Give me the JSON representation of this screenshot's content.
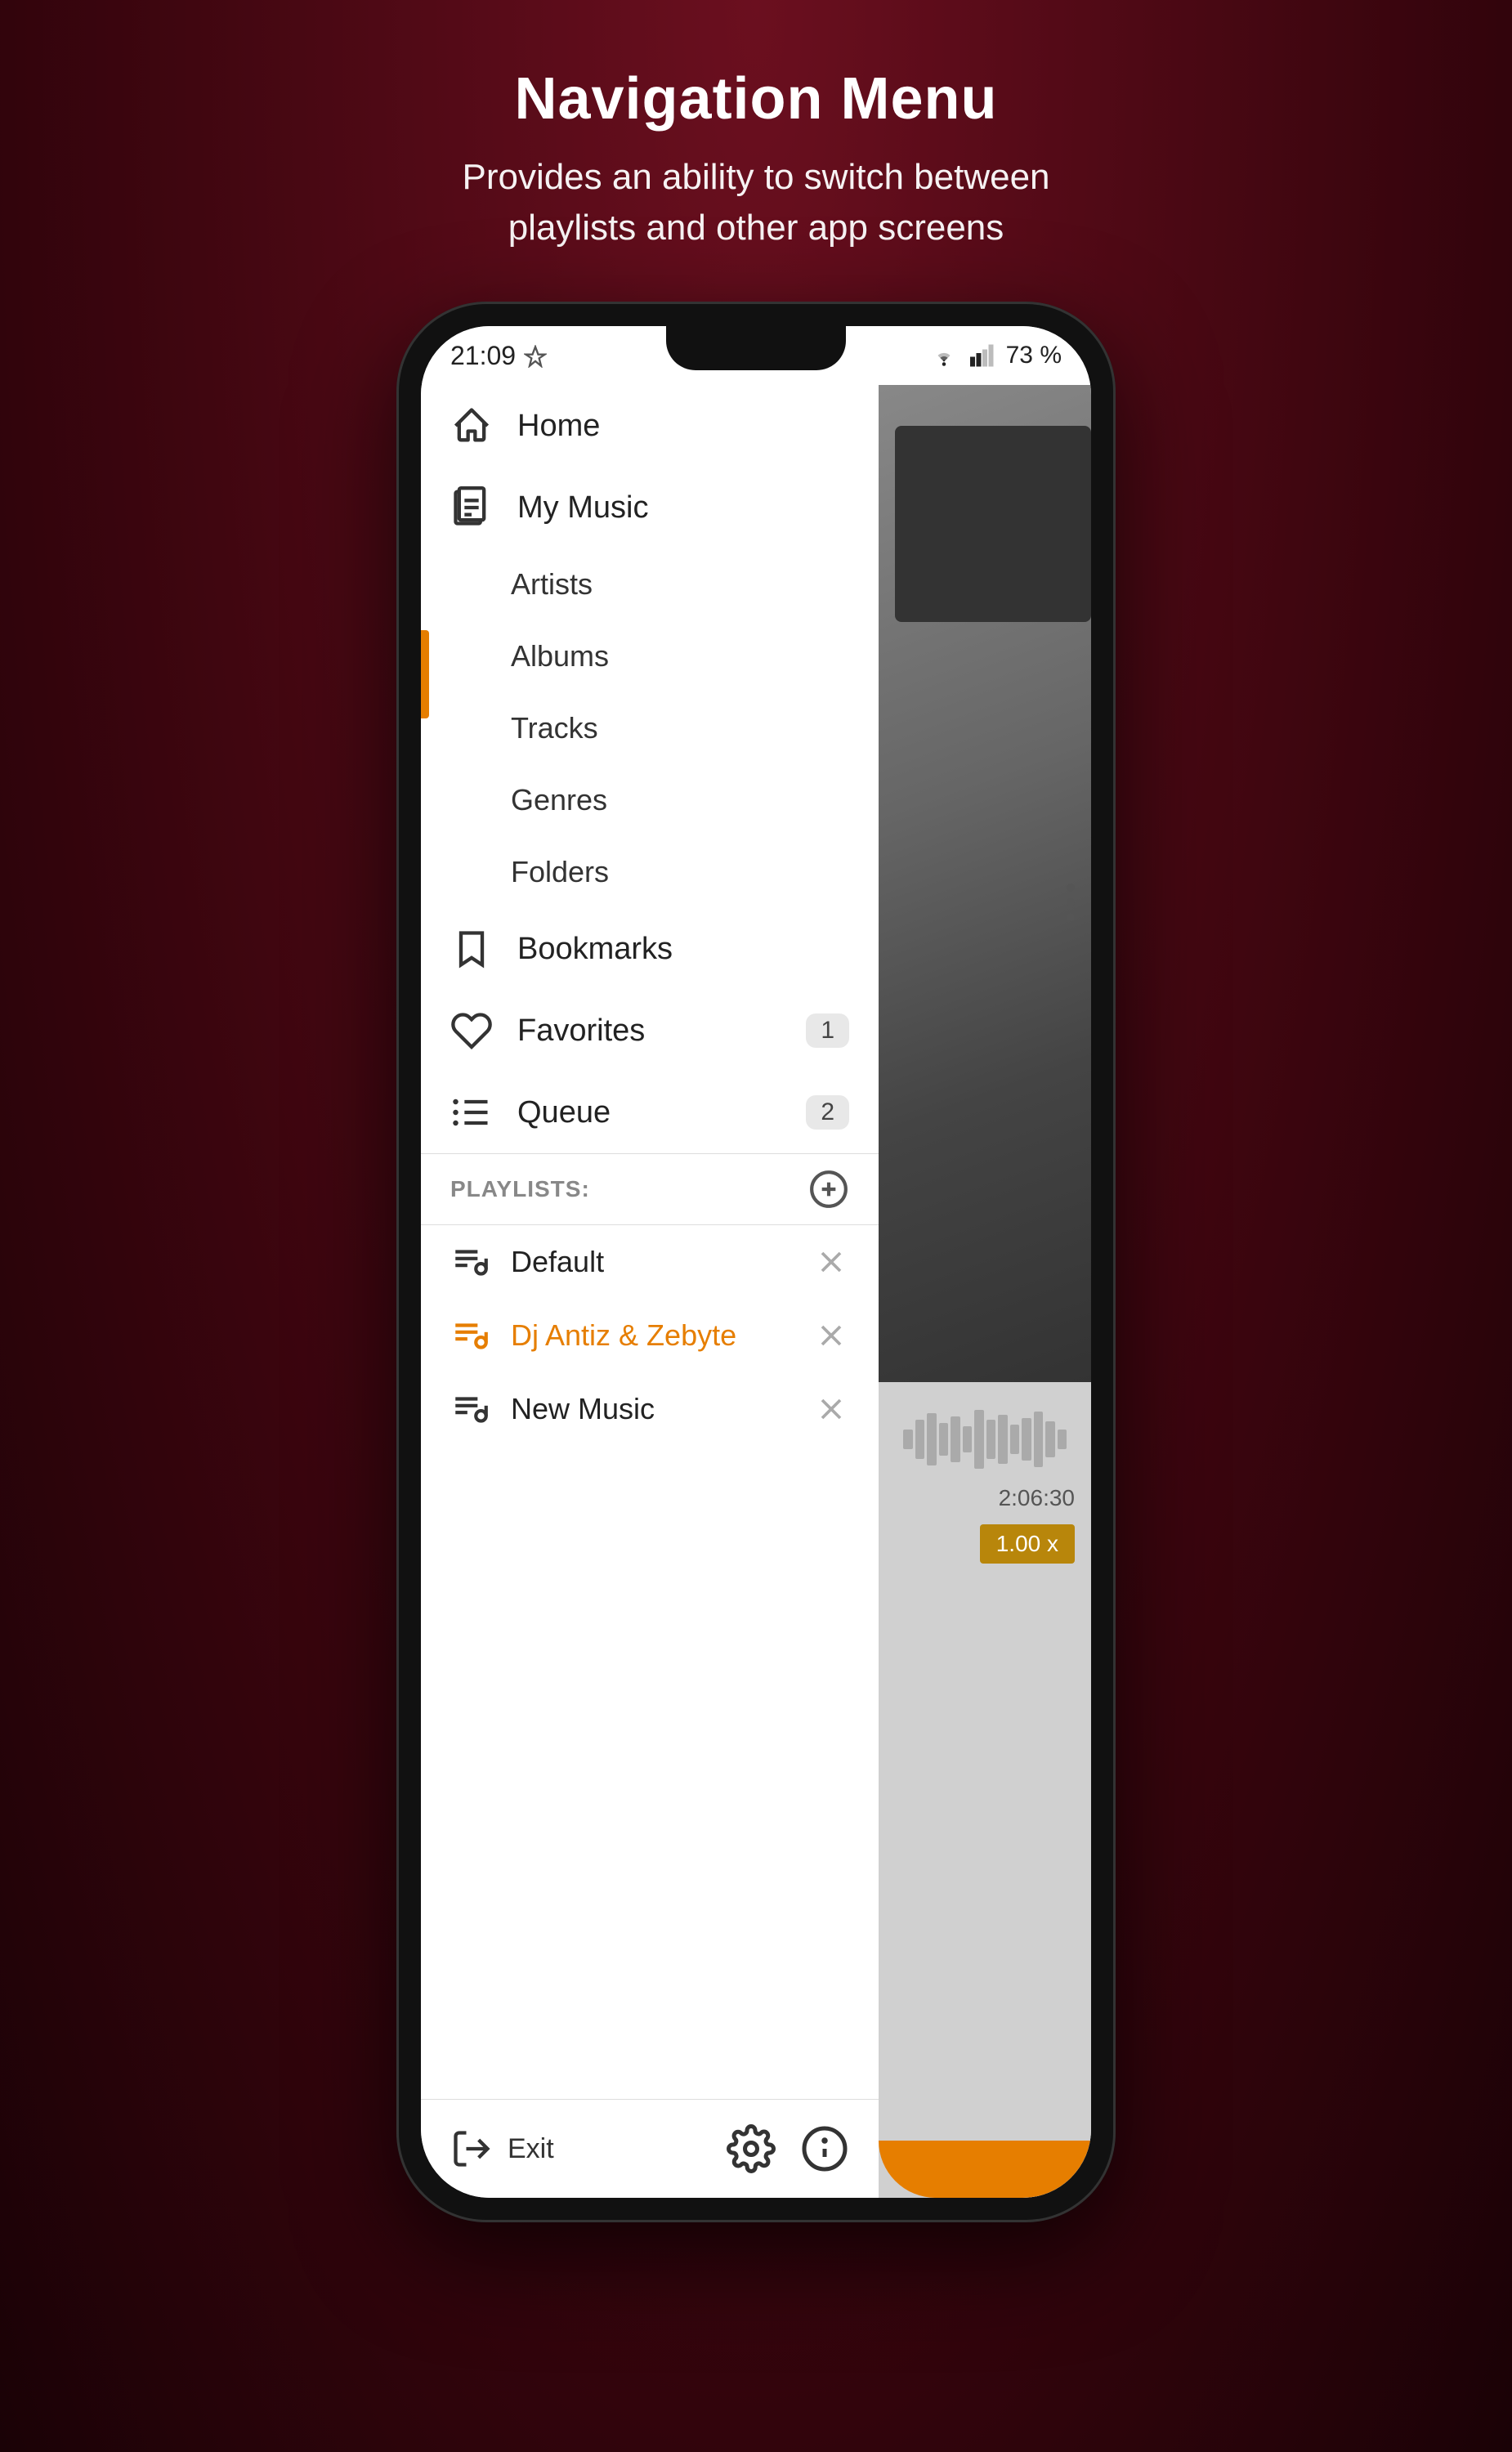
{
  "header": {
    "title": "Navigation Menu",
    "subtitle": "Provides an ability to switch between\nplaylists and other app screens"
  },
  "phone": {
    "statusBar": {
      "time": "21:09",
      "battery": "73 %"
    },
    "drawer": {
      "navItems": [
        {
          "id": "home",
          "label": "Home",
          "icon": "home-icon",
          "hasChildren": false
        },
        {
          "id": "my-music",
          "label": "My Music",
          "icon": "music-library-icon",
          "hasChildren": true
        }
      ],
      "subItems": [
        {
          "id": "artists",
          "label": "Artists"
        },
        {
          "id": "albums",
          "label": "Albums"
        },
        {
          "id": "tracks",
          "label": "Tracks"
        },
        {
          "id": "genres",
          "label": "Genres"
        },
        {
          "id": "folders",
          "label": "Folders"
        }
      ],
      "otherItems": [
        {
          "id": "bookmarks",
          "label": "Bookmarks",
          "icon": "bookmark-icon",
          "badge": null
        },
        {
          "id": "favorites",
          "label": "Favorites",
          "icon": "heart-icon",
          "badge": "1"
        },
        {
          "id": "queue",
          "label": "Queue",
          "icon": "queue-icon",
          "badge": "2"
        }
      ],
      "playlistsSection": {
        "label": "PLAYLISTS:",
        "addButtonLabel": "add-playlist",
        "items": [
          {
            "id": "default",
            "label": "Default",
            "active": false
          },
          {
            "id": "dj-antiz",
            "label": "Dj Antiz & Zebyte",
            "active": true
          },
          {
            "id": "new-music",
            "label": "New Music",
            "active": false
          }
        ]
      },
      "footer": {
        "exitLabel": "Exit",
        "settingsIcon": "settings-icon",
        "infoIcon": "info-icon"
      }
    },
    "rightPanel": {
      "timeDisplay": "2:06:30",
      "speedLabel": "1.00 x"
    }
  },
  "colors": {
    "accent": "#e67e00",
    "accentDark": "#b8860b",
    "background": "#5a0a18",
    "drawerBg": "#ffffff",
    "activeColor": "#e67e00"
  }
}
